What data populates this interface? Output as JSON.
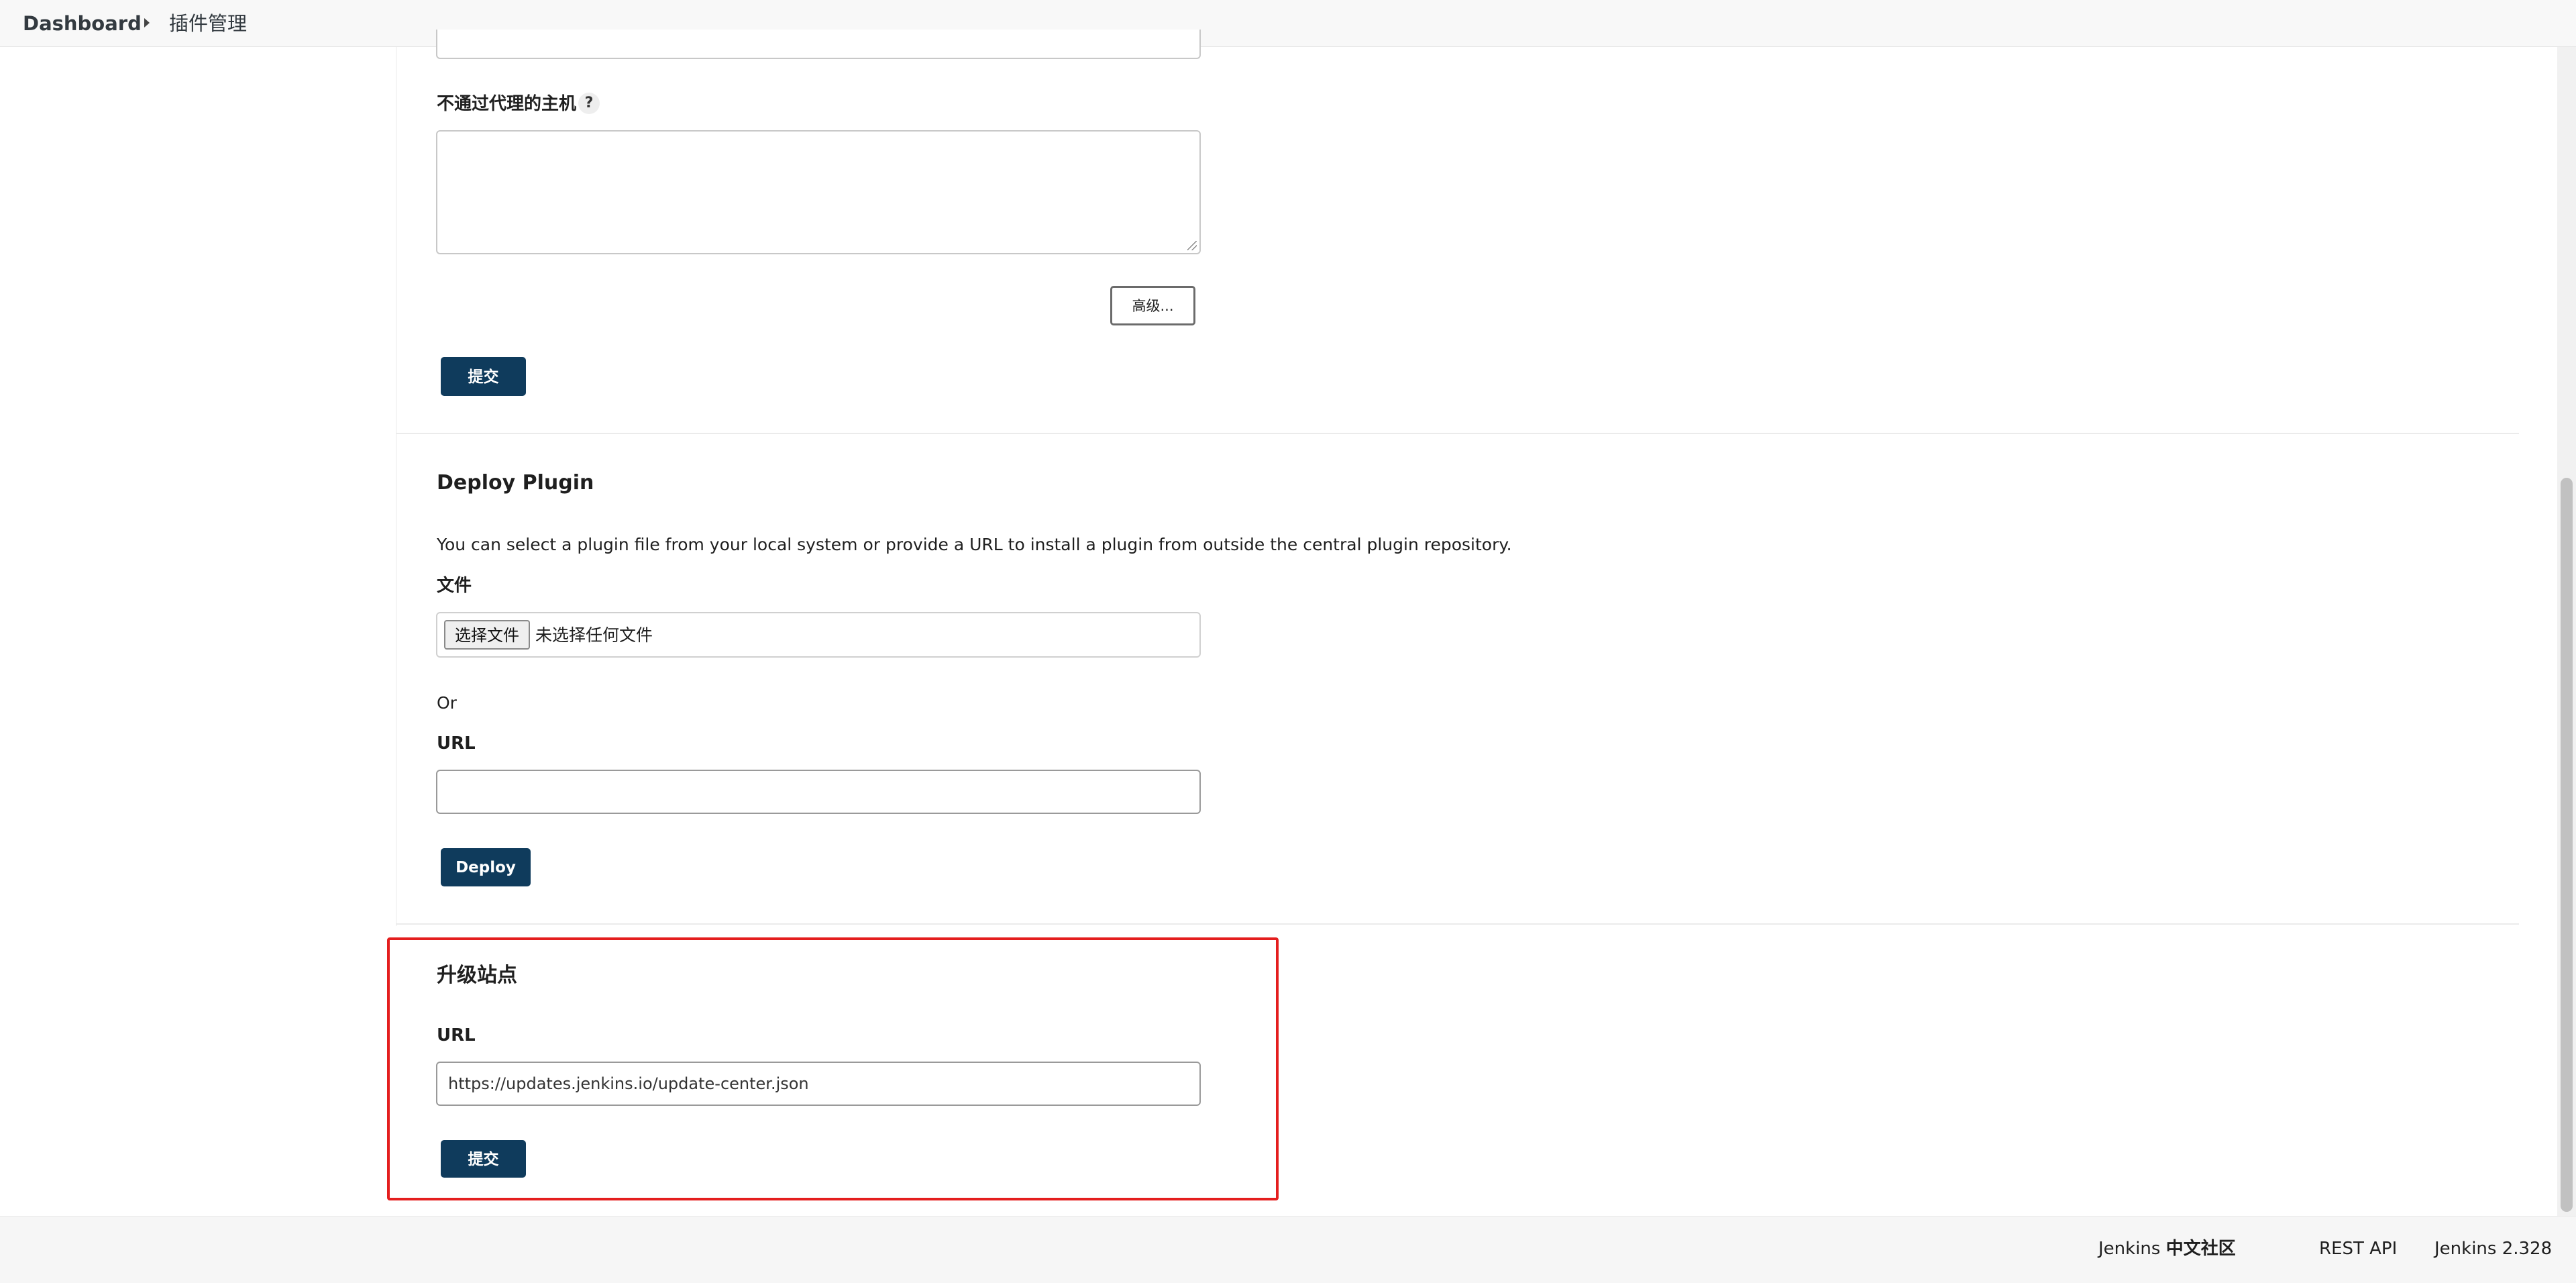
{
  "breadcrumb": {
    "home": "Dashboard",
    "current": "插件管理"
  },
  "proxy": {
    "no_proxy_hosts_label": "不通过代理的主机",
    "help_glyph": "?",
    "no_proxy_hosts_value": "",
    "advanced_button": "高级...",
    "submit_button": "提交"
  },
  "deploy_plugin": {
    "title": "Deploy Plugin",
    "description": "You can select a plugin file from your local system or provide a URL to install a plugin from outside the central plugin repository.",
    "file_label": "文件",
    "choose_file_button": "选择文件",
    "no_file_text": "未选择任何文件",
    "or_text": "Or",
    "url_label": "URL",
    "url_value": "",
    "deploy_button": "Deploy"
  },
  "update_site": {
    "title": "升级站点",
    "url_label": "URL",
    "url_value": "https://updates.jenkins.io/update-center.json",
    "submit_button": "提交"
  },
  "footer": {
    "community_prefix": "Jenkins ",
    "community_suffix": "中文社区",
    "rest_api": "REST API",
    "version": "Jenkins 2.328"
  },
  "colors": {
    "primary_button": "#0f3b5c",
    "highlight": "#e41e1e"
  }
}
